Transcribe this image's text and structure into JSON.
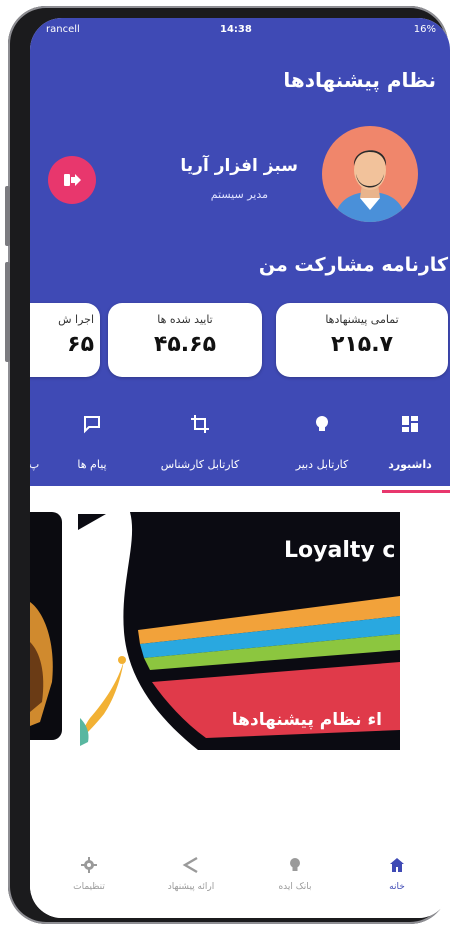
{
  "status_bar": {
    "carrier": "rancell",
    "time": "14:38",
    "battery": "16%"
  },
  "app": {
    "title": "نظام پیشنهادها"
  },
  "profile": {
    "name": "سبز افزار آریا",
    "role": "مدیر سیستم"
  },
  "section_title": "کارنامه مشارکت من",
  "stats": [
    {
      "label": "تمامی پیشنهادها",
      "value": "۲۱۵.۷"
    },
    {
      "label": "تایید شده ها",
      "value": "۴۵.۶۵"
    },
    {
      "label": "اجرا ش",
      "value": "۶۵"
    }
  ],
  "tabs": [
    {
      "label": "داشبورد",
      "icon": "dashboard-icon",
      "active": true
    },
    {
      "label": "کارتابل دبیر",
      "icon": "bulb-icon"
    },
    {
      "label": "کارتابل کارشناس",
      "icon": "crop-icon"
    },
    {
      "label": "پیام ها",
      "icon": "message-icon"
    },
    {
      "label": "پ",
      "icon": ""
    }
  ],
  "carousel": {
    "slide_title": "Loyalty c",
    "slide_subtitle": "اء نظام پیشنهادها"
  },
  "bottom_nav": [
    {
      "label": "خانه",
      "icon": "home-icon",
      "active": true
    },
    {
      "label": "بانک ایده",
      "icon": "bulb-icon"
    },
    {
      "label": "ارائه پیشنهاد",
      "icon": "share-icon"
    },
    {
      "label": "تنظیمات",
      "icon": "gear-icon"
    }
  ],
  "colors": {
    "primary": "#3f4ab5",
    "accent": "#e8376d",
    "avatar_bg": "#f0866b"
  }
}
